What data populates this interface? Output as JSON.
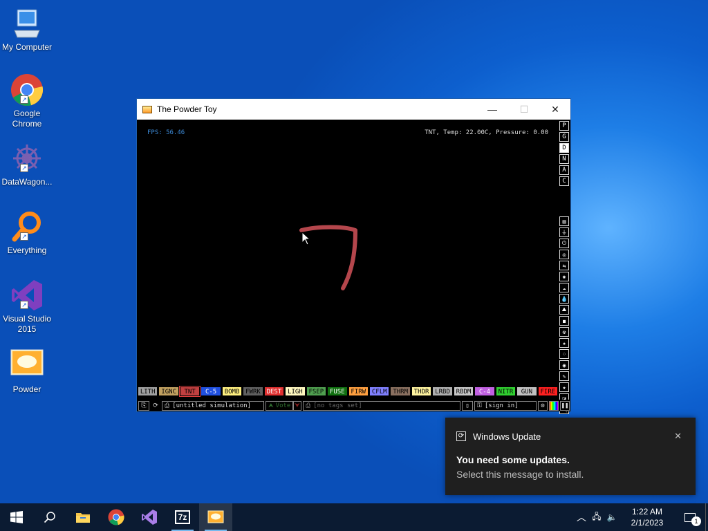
{
  "desktop": {
    "icons": [
      {
        "label": "My Computer",
        "icon": "computer-icon"
      },
      {
        "label": "Google\nChrome",
        "icon": "chrome-icon"
      },
      {
        "label": "DataWagon...",
        "icon": "datawagon-icon"
      },
      {
        "label": "Everything",
        "icon": "everything-icon"
      },
      {
        "label": "Visual Studio\n2015",
        "icon": "visual-studio-icon"
      },
      {
        "label": "Powder",
        "icon": "powder-toy-icon"
      }
    ]
  },
  "window": {
    "title": "The Powder Toy",
    "controls": {
      "minimize": "—",
      "maximize": "☐",
      "close": "✕"
    },
    "hud": {
      "fps": "FPS: 56.46",
      "status": "TNT, Temp: 22.00C, Pressure: 0.00"
    },
    "right_top_buttons": [
      "P",
      "G",
      "D",
      "N",
      "A",
      "C"
    ],
    "right_top_active": "D",
    "right_tool_icons": [
      "walls-icon",
      "electronics-icon",
      "powered-icon",
      "sensors-icon",
      "force-icon",
      "explosives-icon",
      "gases-icon",
      "liquids-icon",
      "powders-icon",
      "solids-icon",
      "radioactive-icon",
      "special-icon",
      "particles-icon",
      "life-icon",
      "tools-icon",
      "favorites-icon",
      "decoration-icon",
      "search-icon"
    ],
    "elements": [
      {
        "label": "LITH",
        "bg": "#a0a0a0",
        "fg": "#000"
      },
      {
        "label": "IGNC",
        "bg": "#c0a060",
        "fg": "#000"
      },
      {
        "label": "TNT",
        "bg": "#c04040",
        "fg": "#000",
        "selected": true
      },
      {
        "label": "C-5",
        "bg": "#2050e0",
        "fg": "#fff"
      },
      {
        "label": "BOMB",
        "bg": "#fff080",
        "fg": "#000"
      },
      {
        "label": "FWRK",
        "bg": "#606060",
        "fg": "#000"
      },
      {
        "label": "DEST",
        "bg": "#e03030",
        "fg": "#fff"
      },
      {
        "label": "LIGH",
        "bg": "#fff8c0",
        "fg": "#000"
      },
      {
        "label": "FSEP",
        "bg": "#50a050",
        "fg": "#000"
      },
      {
        "label": "FUSE",
        "bg": "#107010",
        "fg": "#fff"
      },
      {
        "label": "FIRW",
        "bg": "#ffa040",
        "fg": "#000"
      },
      {
        "label": "CFLM",
        "bg": "#8080ff",
        "fg": "#000"
      },
      {
        "label": "THRM",
        "bg": "#8a7060",
        "fg": "#000"
      },
      {
        "label": "THDR",
        "bg": "#fff4a0",
        "fg": "#000"
      },
      {
        "label": "LRBD",
        "bg": "#b0b0b0",
        "fg": "#000"
      },
      {
        "label": "RBDM",
        "bg": "#c8c8c8",
        "fg": "#000"
      },
      {
        "label": "C-4",
        "bg": "#c060e0",
        "fg": "#fff"
      },
      {
        "label": "NITR",
        "bg": "#30d030",
        "fg": "#000"
      },
      {
        "label": "GUN",
        "bg": "#c0c0c0",
        "fg": "#000"
      },
      {
        "label": "FIRE",
        "bg": "#ff2020",
        "fg": "#000"
      }
    ],
    "bottom_bar": {
      "sim_name": "[untitled simulation]",
      "vote": "Vote",
      "tags": "[no tags set]",
      "sign_in": "[sign in]"
    }
  },
  "toast": {
    "app": "Windows Update",
    "title": "You need some updates.",
    "body": "Select this message to install.",
    "close": "✕"
  },
  "taskbar": {
    "apps": [
      "start-icon",
      "search-icon",
      "file-explorer-icon",
      "chrome-icon",
      "visual-studio-icon",
      "7zip-icon",
      "powder-toy-icon"
    ],
    "time": "1:22 AM",
    "date": "2/1/2023",
    "notification_count": "1"
  }
}
